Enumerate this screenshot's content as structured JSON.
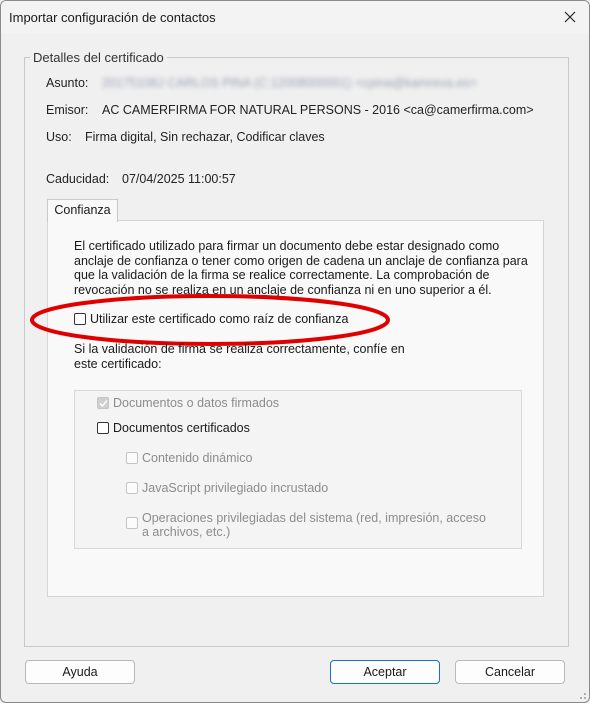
{
  "window": {
    "title": "Importar configuración de contactos"
  },
  "details": {
    "legend": "Detalles del certificado",
    "subject_label": "Asunto:",
    "subject_value": "20175108J CARLOS PINA (C:12008000001) <cpina@kamreva.es>",
    "issuer_label": "Emisor:",
    "issuer_value": "AC CAMERFIRMA FOR NATURAL PERSONS - 2016 <ca@camerfirma.com>",
    "usage_label": "Uso:",
    "usage_value": "Firma digital, Sin rechazar, Codificar claves",
    "expiry_label": "Caducidad:",
    "expiry_value": "07/04/2025 11:00:57"
  },
  "tab": {
    "label": "Confianza"
  },
  "trust": {
    "line1": "El certificado utilizado para firmar un documento debe estar designado como",
    "line2": "anclaje de confianza o tener como origen de cadena un anclaje de confianza para",
    "line3": "que la validación de la firma se realice correctamente. La comprobación de",
    "line4": "revocación no se realiza en un anclaje de confianza ni en uno superior a él.",
    "root_checkbox_label": "Utilizar este certificado como raíz de confianza",
    "trust_line1": "Si la validación de firma se realiza correctamente, confíe en",
    "trust_line2": "este certificado:",
    "opt_signed_docs": "Documentos o datos firmados",
    "opt_certified_docs": "Documentos certificados",
    "opt_dynamic": "Contenido dinámico",
    "opt_javascript": "JavaScript privilegiado incrustado",
    "opt_sysops_line1": "Operaciones privilegiadas del sistema (red, impresión, acceso",
    "opt_sysops_line2": "a archivos, etc.)"
  },
  "buttons": {
    "help": "Ayuda",
    "accept": "Aceptar",
    "cancel": "Cancelar"
  },
  "colors": {
    "annotation": "#e00000",
    "primary_border": "#1a6fc9"
  },
  "icons": {
    "close": "close-icon",
    "check": "checkmark-icon",
    "grip": "resize-grip-icon"
  }
}
